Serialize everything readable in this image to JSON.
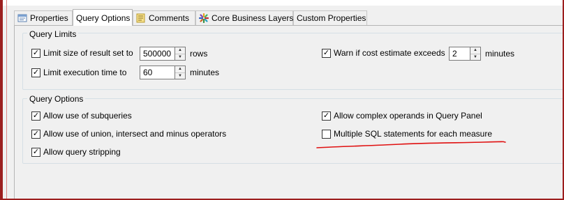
{
  "tabs": [
    {
      "label": "Properties",
      "icon": "properties-icon",
      "active": false
    },
    {
      "label": "Query Options",
      "icon": "",
      "active": true
    },
    {
      "label": "Comments",
      "icon": "comments-icon",
      "active": false
    },
    {
      "label": "Core Business Layers",
      "icon": "business-layer-icon",
      "active": false
    },
    {
      "label": "Custom Properties",
      "icon": "",
      "active": false
    }
  ],
  "query_limits": {
    "title": "Query Limits",
    "limit_size": {
      "label": "Limit size of result set to",
      "checked": true,
      "value": "500000",
      "unit": "rows"
    },
    "limit_time": {
      "label": "Limit execution time to",
      "checked": true,
      "value": "60",
      "unit": "minutes"
    },
    "warn_cost": {
      "label": "Warn if cost estimate exceeds",
      "checked": true,
      "value": "2",
      "unit": "minutes"
    }
  },
  "query_options": {
    "title": "Query Options",
    "subqueries": {
      "label": "Allow use of subqueries",
      "checked": true
    },
    "union": {
      "label": "Allow use of union, intersect and minus operators",
      "checked": true
    },
    "stripping": {
      "label": "Allow query stripping",
      "checked": true
    },
    "complex_operands": {
      "label": "Allow complex operands in Query Panel",
      "checked": true
    },
    "multiple_sql": {
      "label": "Multiple SQL statements for each measure",
      "checked": false
    }
  },
  "colors": {
    "annotation": "#e01010",
    "frame": "#9c1e1e",
    "group_border": "#d5dfe5"
  }
}
